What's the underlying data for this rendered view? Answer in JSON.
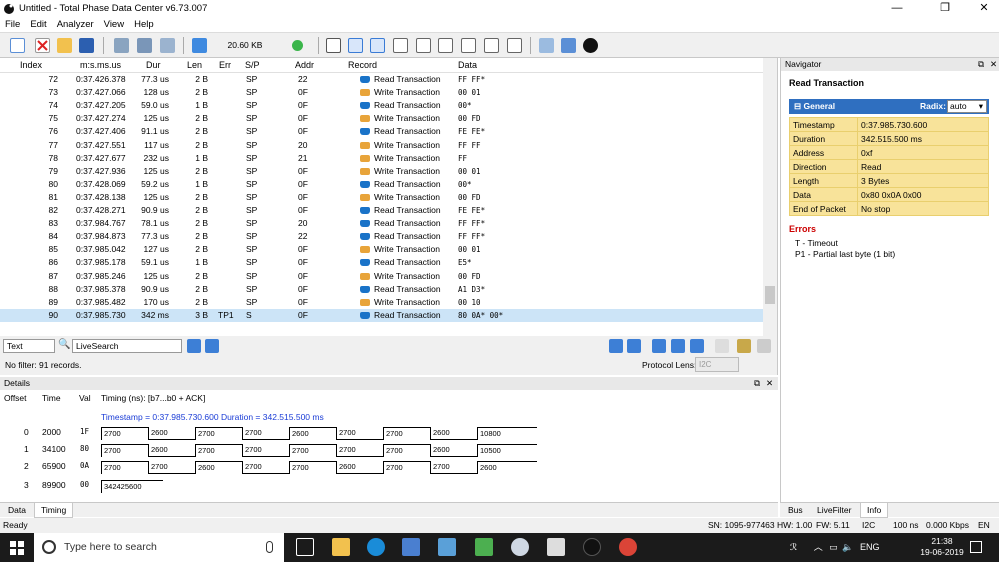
{
  "window": {
    "title": "Untitled - Total Phase Data Center v6.73.007",
    "minimize": "—",
    "maximize": "❐",
    "close": "✕"
  },
  "menu": [
    "File",
    "Edit",
    "Analyzer",
    "View",
    "Help"
  ],
  "toolbar": {
    "capture_size": "20.60 KB"
  },
  "table": {
    "headers": {
      "index": "Index",
      "timestamp": "m:s.ms.us",
      "duration": "Dur",
      "length": "Len",
      "error": "Err",
      "sp": "S/P",
      "address": "Addr",
      "record": "Record",
      "data": "Data"
    },
    "rows": [
      {
        "index": "72",
        "ts": "0:37.426.378",
        "dur": "77.3 us",
        "len": "2 B",
        "err": "",
        "sp": "SP",
        "addr": "22",
        "rec": "Read Transaction",
        "type": "r",
        "data": "FF FF*"
      },
      {
        "index": "73",
        "ts": "0:37.427.066",
        "dur": "128 us",
        "len": "2 B",
        "err": "",
        "sp": "SP",
        "addr": "0F",
        "rec": "Write Transaction",
        "type": "w",
        "data": "00 01"
      },
      {
        "index": "74",
        "ts": "0:37.427.205",
        "dur": "59.0 us",
        "len": "1 B",
        "err": "",
        "sp": "SP",
        "addr": "0F",
        "rec": "Read Transaction",
        "type": "r",
        "data": "00*"
      },
      {
        "index": "75",
        "ts": "0:37.427.274",
        "dur": "125 us",
        "len": "2 B",
        "err": "",
        "sp": "SP",
        "addr": "0F",
        "rec": "Write Transaction",
        "type": "w",
        "data": "00 FD"
      },
      {
        "index": "76",
        "ts": "0:37.427.406",
        "dur": "91.1 us",
        "len": "2 B",
        "err": "",
        "sp": "SP",
        "addr": "0F",
        "rec": "Read Transaction",
        "type": "r",
        "data": "FE FE*"
      },
      {
        "index": "77",
        "ts": "0:37.427.551",
        "dur": "117 us",
        "len": "2 B",
        "err": "",
        "sp": "SP",
        "addr": "20",
        "rec": "Write Transaction",
        "type": "w",
        "data": "FF FF"
      },
      {
        "index": "78",
        "ts": "0:37.427.677",
        "dur": "232 us",
        "len": "1 B",
        "err": "",
        "sp": "SP",
        "addr": "21",
        "rec": "Write Transaction",
        "type": "w",
        "data": "FF"
      },
      {
        "index": "79",
        "ts": "0:37.427.936",
        "dur": "125 us",
        "len": "2 B",
        "err": "",
        "sp": "SP",
        "addr": "0F",
        "rec": "Write Transaction",
        "type": "w",
        "data": "00 01"
      },
      {
        "index": "80",
        "ts": "0:37.428.069",
        "dur": "59.2 us",
        "len": "1 B",
        "err": "",
        "sp": "SP",
        "addr": "0F",
        "rec": "Read Transaction",
        "type": "r",
        "data": "00*"
      },
      {
        "index": "81",
        "ts": "0:37.428.138",
        "dur": "125 us",
        "len": "2 B",
        "err": "",
        "sp": "SP",
        "addr": "0F",
        "rec": "Write Transaction",
        "type": "w",
        "data": "00 FD"
      },
      {
        "index": "82",
        "ts": "0:37.428.271",
        "dur": "90.9 us",
        "len": "2 B",
        "err": "",
        "sp": "SP",
        "addr": "0F",
        "rec": "Read Transaction",
        "type": "r",
        "data": "FE FE*"
      },
      {
        "index": "83",
        "ts": "0:37.984.767",
        "dur": "78.1 us",
        "len": "2 B",
        "err": "",
        "sp": "SP",
        "addr": "20",
        "rec": "Read Transaction",
        "type": "r",
        "data": "FF FF*"
      },
      {
        "index": "84",
        "ts": "0:37.984.873",
        "dur": "77.3 us",
        "len": "2 B",
        "err": "",
        "sp": "SP",
        "addr": "22",
        "rec": "Read Transaction",
        "type": "r",
        "data": "FF FF*"
      },
      {
        "index": "85",
        "ts": "0:37.985.042",
        "dur": "127 us",
        "len": "2 B",
        "err": "",
        "sp": "SP",
        "addr": "0F",
        "rec": "Write Transaction",
        "type": "w",
        "data": "00 01"
      },
      {
        "index": "86",
        "ts": "0:37.985.178",
        "dur": "59.1 us",
        "len": "1 B",
        "err": "",
        "sp": "SP",
        "addr": "0F",
        "rec": "Read Transaction",
        "type": "r",
        "data": "E5*"
      },
      {
        "index": "87",
        "ts": "0:37.985.246",
        "dur": "125 us",
        "len": "2 B",
        "err": "",
        "sp": "SP",
        "addr": "0F",
        "rec": "Write Transaction",
        "type": "w",
        "data": "00 FD"
      },
      {
        "index": "88",
        "ts": "0:37.985.378",
        "dur": "90.9 us",
        "len": "2 B",
        "err": "",
        "sp": "SP",
        "addr": "0F",
        "rec": "Read Transaction",
        "type": "r",
        "data": "A1 D3*"
      },
      {
        "index": "89",
        "ts": "0:37.985.482",
        "dur": "170 us",
        "len": "2 B",
        "err": "",
        "sp": "SP",
        "addr": "0F",
        "rec": "Write Transaction",
        "type": "w",
        "data": "00 10"
      },
      {
        "index": "90",
        "ts": "0:37.985.730",
        "dur": "342 ms",
        "len": "3 B",
        "err": "TP1",
        "sp": "S",
        "addr": "0F",
        "rec": "Read Transaction",
        "type": "r",
        "data": "80 0A* 00*",
        "selected": true
      }
    ]
  },
  "filter": {
    "mode": "Text",
    "search": "LiveSearch",
    "status": "No filter: 91 records.",
    "protocol_lens_label": "Protocol Lens:",
    "protocol_lens": "I2C"
  },
  "navigator": {
    "title": "Navigator",
    "record_title": "Read Transaction",
    "section": "General",
    "radix_label": "Radix:",
    "radix": "auto",
    "props": [
      {
        "k": "Timestamp",
        "v": "0:37.985.730.600"
      },
      {
        "k": "Duration",
        "v": "342.515.500 ms"
      },
      {
        "k": "Address",
        "v": "0xf"
      },
      {
        "k": "Direction",
        "v": "Read"
      },
      {
        "k": "Length",
        "v": "3 Bytes"
      },
      {
        "k": "Data",
        "v": "0x80 0x0A 0x00"
      },
      {
        "k": "End of Packet",
        "v": "No stop"
      }
    ],
    "errors_title": "Errors",
    "errors": [
      "T - Timeout",
      "P1 - Partial last byte (1 bit)"
    ]
  },
  "details": {
    "title": "Details",
    "headers": {
      "offset": "Offset",
      "time": "Time",
      "val": "Val",
      "timing": "Timing (ns): [b7...b0 + ACK]"
    },
    "summary": "Timestamp = 0:37.985.730.600  Duration = 342.515.500 ms",
    "rows": [
      {
        "offset": "0",
        "time": "2000",
        "val": "1F",
        "segs": [
          "2700",
          "2600",
          "2700",
          "2700",
          "2600",
          "2700",
          "2700",
          "2600",
          "10800"
        ]
      },
      {
        "offset": "1",
        "time": "34100",
        "val": "80",
        "segs": [
          "2700",
          "2600",
          "2700",
          "2700",
          "2700",
          "2700",
          "2700",
          "2600",
          "10500"
        ]
      },
      {
        "offset": "2",
        "time": "65900",
        "val": "0A",
        "segs": [
          "2700",
          "2700",
          "2600",
          "2700",
          "2700",
          "2600",
          "2700",
          "2700",
          "2600"
        ]
      },
      {
        "offset": "3",
        "time": "89900",
        "val": "00",
        "segs": [
          "342425600"
        ]
      }
    ]
  },
  "bottom_tabs": [
    "Data",
    "Timing"
  ],
  "right_tabs": [
    "Bus",
    "LiveFilter",
    "Info"
  ],
  "status": {
    "ready": "Ready",
    "sn": "SN: 1095-977463",
    "hw": "HW: 1.00",
    "fw": "FW: 5.11",
    "proto": "I2C",
    "ns": "100 ns",
    "rate": "0.000 Kbps",
    "lang": "EN"
  },
  "taskbar": {
    "search_placeholder": "Type here to search",
    "lang": "ENG",
    "time": "21:38",
    "date": "19-06-2019"
  }
}
